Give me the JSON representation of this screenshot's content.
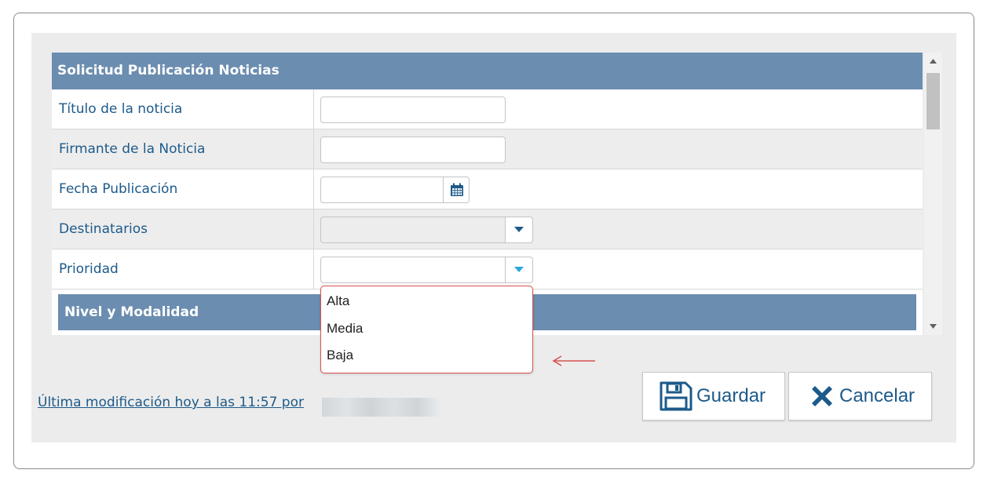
{
  "form": {
    "title": "Solicitud Publicación Noticias",
    "fields": [
      {
        "label": "Título de la noticia",
        "value": ""
      },
      {
        "label": "Firmante de la Noticia",
        "value": ""
      },
      {
        "label": "Fecha Publicación",
        "value": ""
      },
      {
        "label": "Destinatarios",
        "value": ""
      },
      {
        "label": "Prioridad",
        "value": ""
      }
    ],
    "subsection_title": "Nivel y Modalidad"
  },
  "dropdown": {
    "options": [
      "Alta",
      "Media",
      "Baja"
    ]
  },
  "footer": {
    "last_modified": "Última modificación hoy a las 11:57 por"
  },
  "buttons": {
    "save_label": "Guardar",
    "cancel_label": "Cancelar"
  },
  "colors": {
    "header_bg": "#6b8db0",
    "label_text": "#1d5a8a",
    "annotation": "#d9534f"
  },
  "icons": {
    "date": "calendar-icon",
    "select_arrow": "chevron-down-icon",
    "save": "floppy-disk-icon",
    "cancel": "x-icon"
  }
}
